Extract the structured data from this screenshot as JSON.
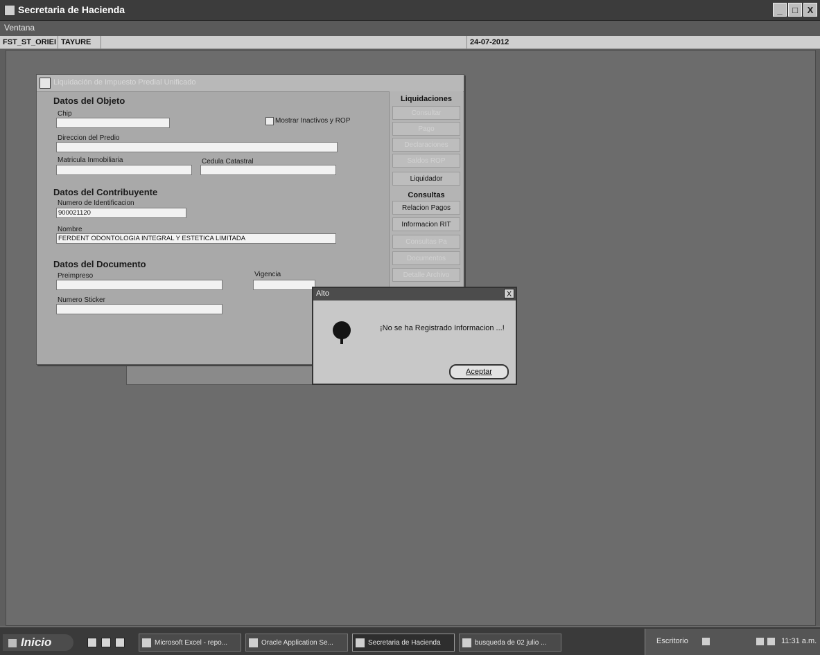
{
  "window": {
    "title": "Secretaria de Hacienda",
    "controls": [
      "_",
      "□",
      "X"
    ]
  },
  "menubar": {
    "label": "Ventana"
  },
  "statusbar": {
    "user_code": "FST_ST_ORIEI",
    "user_name": "TAYURE",
    "date": "24-07-2012"
  },
  "form": {
    "title": "Liquidación de Impuesto Predial Unificado",
    "objeto": {
      "heading": "Datos del Objeto",
      "chip_label": "Chip",
      "chip_value": "",
      "inactive_label": "Mostrar Inactivos y ROP",
      "direccion_label": "Direccion del Predio",
      "direccion_value": "",
      "matricula_label": "Matricula Inmobiliaria",
      "matricula_value": "",
      "cedula_label": "Cedula Catastral",
      "cedula_value": ""
    },
    "contribuyente": {
      "heading": "Datos del Contribuyente",
      "id_label": "Numero de Identificacion",
      "id_value": "900021120",
      "nombre_label": "Nombre",
      "nombre_value": "FERDENT ODONTOLOGIA INTEGRAL Y ESTETICA LIMITADA"
    },
    "documento": {
      "heading": "Datos del Documento",
      "preimpreso_label": "Preimpreso",
      "preimpreso_value": "",
      "vigencia_label": "Vigencia",
      "vigencia_value": "",
      "sticker_label": "Numero Sticker",
      "sticker_value": ""
    },
    "side": {
      "liquidaciones_heading": "Liquidaciones",
      "liq_buttons": [
        "Consultar",
        "Pago",
        "Declaraciones",
        "Saldos ROP",
        "Liquidador"
      ],
      "consultas_heading": "Consultas",
      "cons_buttons": [
        "Relacion Pagos",
        "Informacion RIT",
        "Consultas Pa",
        "Documentos",
        "Detalle Archivo"
      ]
    }
  },
  "alert": {
    "title": "Alto",
    "close": "X",
    "message": "¡No se ha Registrado Informacion ...!",
    "button": "Aceptar"
  },
  "taskbar": {
    "start": "Inicio",
    "items": [
      "Microsoft Excel - repo...",
      "Oracle Application Se...",
      "Secretaria de Hacienda",
      "busqueda de 02 julio ..."
    ],
    "tray_label": "Escritorio",
    "clock": "11:31 a.m."
  }
}
